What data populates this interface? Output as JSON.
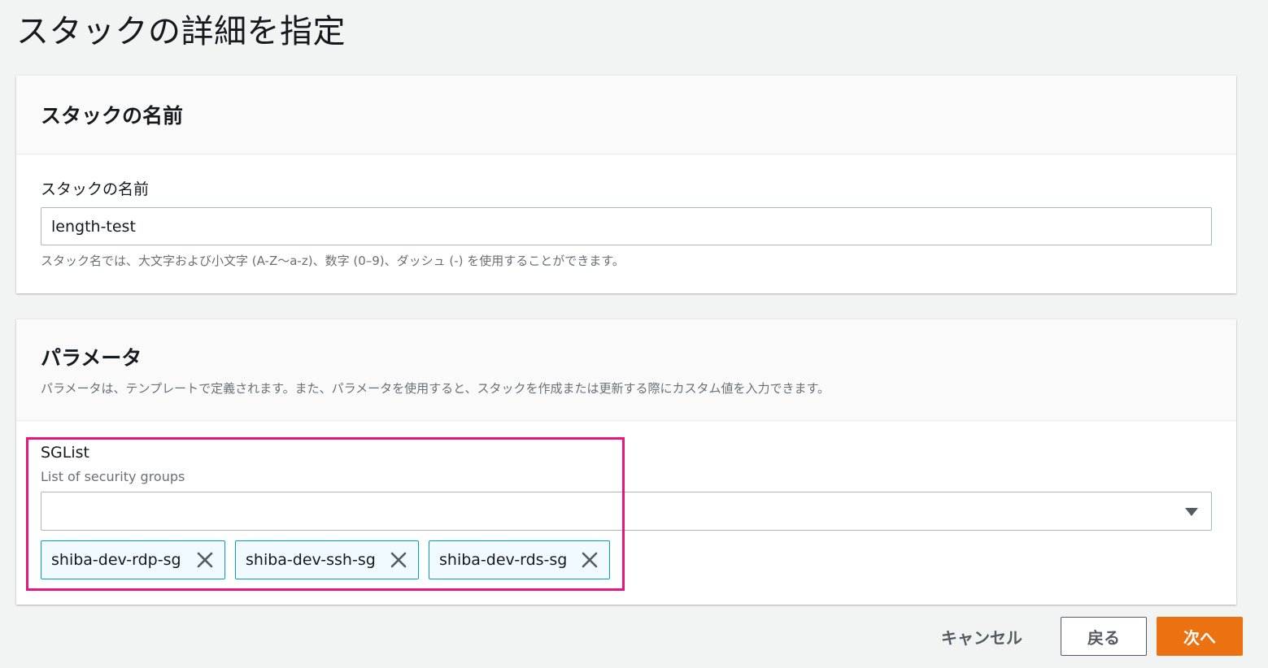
{
  "page": {
    "title": "スタックの詳細を指定"
  },
  "stack_name_panel": {
    "title": "スタックの名前",
    "field_label": "スタックの名前",
    "input_value": "length-test",
    "constraint": "スタック名では、大文字および小文字 (A-Z～a-z)、数字 (0–9)、ダッシュ (-) を使用することができます。"
  },
  "parameters_panel": {
    "title": "パラメータ",
    "description": "パラメータは、テンプレートで定義されます。また、パラメータを使用すると、スタックを作成または更新する際にカスタム値を入力できます。",
    "sglist": {
      "label": "SGList",
      "description": "List of security groups",
      "select_value": "",
      "tokens": [
        "shiba-dev-rdp-sg",
        "shiba-dev-ssh-sg",
        "shiba-dev-rds-sg"
      ]
    }
  },
  "footer": {
    "cancel_label": "キャンセル",
    "back_label": "戻る",
    "next_label": "次へ"
  },
  "colors": {
    "primary_button": "#ec7211",
    "token_border": "#00a1c9",
    "token_background": "#f1faff",
    "highlight": "#e8177c"
  },
  "icons": {
    "select_caret": "caret-down-icon",
    "token_remove": "close-icon"
  }
}
